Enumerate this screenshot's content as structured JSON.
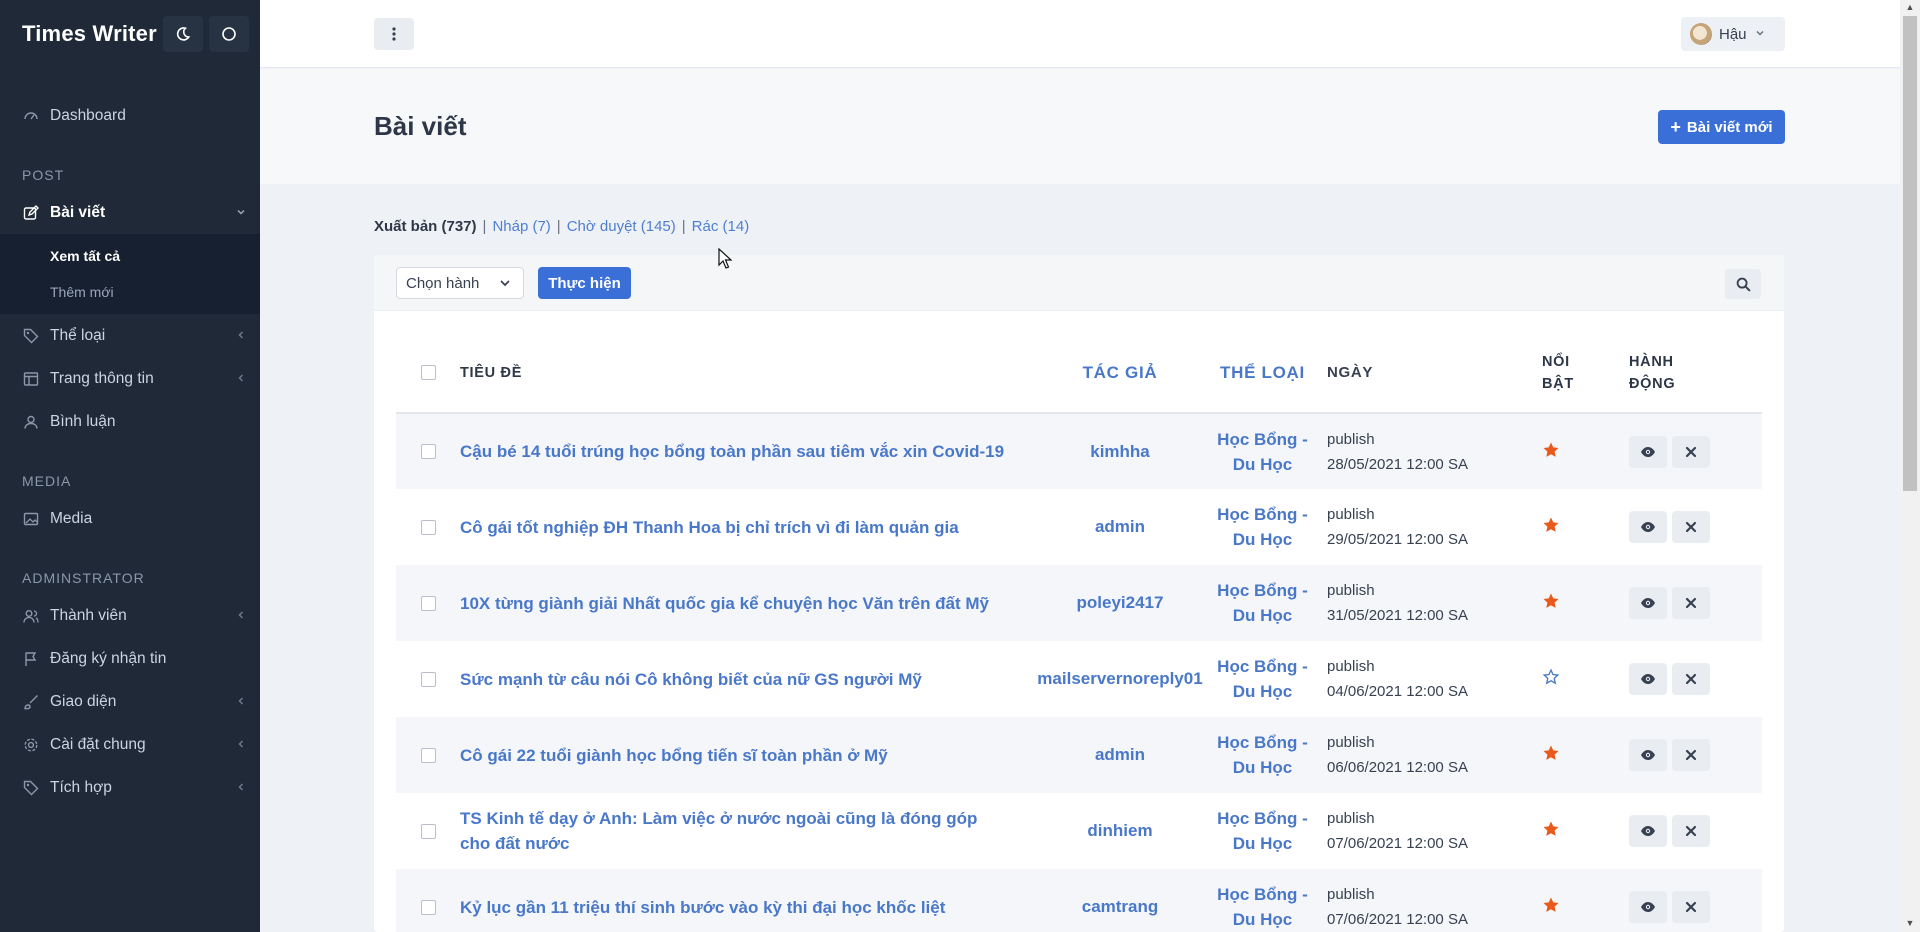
{
  "app": {
    "title": "Times Writer"
  },
  "sidebar": {
    "dashboard": "Dashboard",
    "section_post": "POST",
    "posts": "Bài viết",
    "posts_sub": [
      "Xem tất cả",
      "Thêm mới"
    ],
    "categories": "Thể loại",
    "pages": "Trang thông tin",
    "comments": "Bình luận",
    "section_media": "MEDIA",
    "media": "Media",
    "section_admin": "ADMINSTRATOR",
    "members": "Thành viên",
    "subscribers": "Đăng ký nhận tin",
    "appearance": "Giao diện",
    "settings": "Cài đặt chung",
    "integrations": "Tích hợp"
  },
  "topbar": {
    "user_name": "Hậu"
  },
  "page": {
    "title": "Bài viết",
    "new_button": "Bài viết mới"
  },
  "filters": {
    "published": "Xuất bản (737)",
    "draft": "Nháp (7)",
    "pending": "Chờ duyệt (145)",
    "trash": "Rác (14)"
  },
  "toolbar": {
    "bulk_select": "Chọn hành",
    "apply": "Thực hiện"
  },
  "table": {
    "headers": {
      "title": "TIÊU ĐỀ",
      "author": "TÁC GIẢ",
      "category": "THỂ LOẠI",
      "date": "NGÀY",
      "featured_1": "NỔI",
      "featured_2": "BẬT",
      "actions_1": "HÀNH",
      "actions_2": "ĐỘNG"
    },
    "rows": [
      {
        "title": "Cậu bé 14 tuổi trúng học bổng toàn phần sau tiêm vắc xin Covid-19",
        "author": "kimhha",
        "category": "Học Bổng - Du Học",
        "status": "publish",
        "date": "28/05/2021 12:00 SA",
        "featured": true
      },
      {
        "title": "Cô gái tốt nghiệp ĐH Thanh Hoa bị chỉ trích vì đi làm quản gia",
        "author": "admin",
        "category": "Học Bổng - Du Học",
        "status": "publish",
        "date": "29/05/2021 12:00 SA",
        "featured": true
      },
      {
        "title": "10X từng giành giải Nhất quốc gia kể chuyện học Văn trên đất Mỹ",
        "author": "poleyi2417",
        "category": "Học Bổng - Du Học",
        "status": "publish",
        "date": "31/05/2021 12:00 SA",
        "featured": true
      },
      {
        "title": "Sức mạnh từ câu nói Cô không biết của nữ GS người Mỹ",
        "author": "mailservernoreply01",
        "category": "Học Bổng - Du Học",
        "status": "publish",
        "date": "04/06/2021 12:00 SA",
        "featured": false
      },
      {
        "title": "Cô gái 22 tuổi giành học bổng tiến sĩ toàn phần ở Mỹ",
        "author": "admin",
        "category": "Học Bổng - Du Học",
        "status": "publish",
        "date": "06/06/2021 12:00 SA",
        "featured": true
      },
      {
        "title": "TS Kinh tế dạy ở Anh: Làm việc ở nước ngoài cũng là đóng góp cho đất nước",
        "author": "dinhiem",
        "category": "Học Bổng - Du Học",
        "status": "publish",
        "date": "07/06/2021 12:00 SA",
        "featured": true
      },
      {
        "title": "Kỷ lục gần 11 triệu thí sinh bước vào kỳ thi đại học khốc liệt",
        "author": "camtrang",
        "category": "Học Bổng - Du Học",
        "status": "publish",
        "date": "07/06/2021 12:00 SA",
        "featured": true
      }
    ]
  },
  "colors": {
    "sidebar_bg": "#1f2937",
    "accent": "#3b6fd8",
    "link": "#4a78c9",
    "star": "#e8591a",
    "star_outline": "#4a78c9"
  },
  "icons": {
    "theme": "moon-icon",
    "circle": "circle-icon",
    "menu": "kebab-icon",
    "search": "search-icon",
    "view": "eye-icon",
    "delete": "close-icon",
    "featured": "star-icon"
  }
}
